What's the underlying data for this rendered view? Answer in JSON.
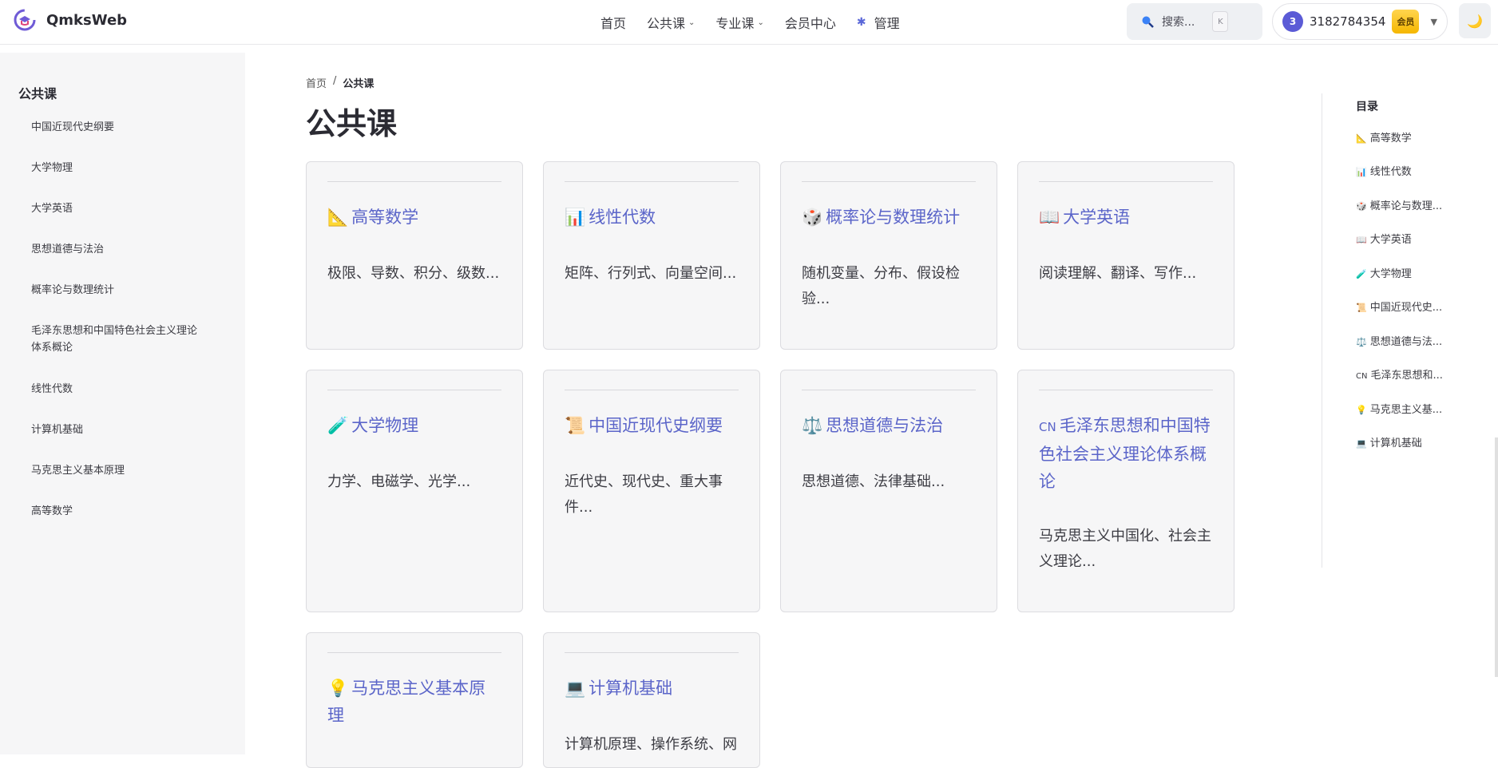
{
  "header": {
    "site_name": "QmksWeb",
    "nav": [
      {
        "label": "首页",
        "has_caret": false
      },
      {
        "label": "公共课",
        "has_caret": true
      },
      {
        "label": "专业课",
        "has_caret": true
      },
      {
        "label": "会员中心",
        "has_caret": false
      }
    ],
    "admin_label": "管理",
    "search_placeholder": "搜索...",
    "search_shortcut": "K",
    "user": {
      "avatar_initial": "3",
      "id": "3182784354",
      "badge": "会员"
    },
    "theme_icon": "moon-icon"
  },
  "sidebar": {
    "title": "公共课",
    "items": [
      "中国近现代史纲要",
      "大学物理",
      "大学英语",
      "思想道德与法治",
      "概率论与数理统计",
      "毛泽东思想和中国特色社会主义理论体系概论",
      "线性代数",
      "计算机基础",
      "马克思主义基本原理",
      "高等数学"
    ]
  },
  "breadcrumb": {
    "home": "首页",
    "separator": "/",
    "current": "公共课"
  },
  "page_title": "公共课",
  "cards": [
    {
      "icon": "📐",
      "title": "高等数学",
      "desc": "极限、导数、积分、级数..."
    },
    {
      "icon": "📊",
      "title": "线性代数",
      "desc": "矩阵、行列式、向量空间..."
    },
    {
      "icon": "🎲",
      "title": "概率论与数理统计",
      "desc": "随机变量、分布、假设检验..."
    },
    {
      "icon": "📖",
      "title": "大学英语",
      "desc": "阅读理解、翻译、写作..."
    },
    {
      "icon": "🧪",
      "title": "大学物理",
      "desc": "力学、电磁学、光学..."
    },
    {
      "icon": "📜",
      "title": "中国近现代史纲要",
      "desc": "近代史、现代史、重大事件..."
    },
    {
      "icon": "⚖️",
      "title": "思想道德与法治",
      "desc": "思想道德、法律基础..."
    },
    {
      "icon": "CN",
      "title": "毛泽东思想和中国特色社会主义理论体系概论",
      "desc": "马克思主义中国化、社会主义理论..."
    },
    {
      "icon": "💡",
      "title": "马克思主义基本原理",
      "desc": ""
    },
    {
      "icon": "💻",
      "title": "计算机基础",
      "desc": "计算机原理、操作系统、网"
    }
  ],
  "toc": {
    "title": "目录",
    "items": [
      {
        "icon": "📐",
        "label": "高等数学"
      },
      {
        "icon": "📊",
        "label": "线性代数"
      },
      {
        "icon": "🎲",
        "label": "概率论与数理..."
      },
      {
        "icon": "📖",
        "label": "大学英语"
      },
      {
        "icon": "🧪",
        "label": "大学物理"
      },
      {
        "icon": "📜",
        "label": "中国近现代史..."
      },
      {
        "icon": "⚖️",
        "label": "思想道德与法..."
      },
      {
        "icon": "CN",
        "label": "毛泽东思想和..."
      },
      {
        "icon": "💡",
        "label": "马克思主义基..."
      },
      {
        "icon": "💻",
        "label": "计算机基础"
      }
    ]
  },
  "colors": {
    "accent": "#5b65c9",
    "avatar": "#5b5bd6",
    "badge": "#f5b700"
  }
}
